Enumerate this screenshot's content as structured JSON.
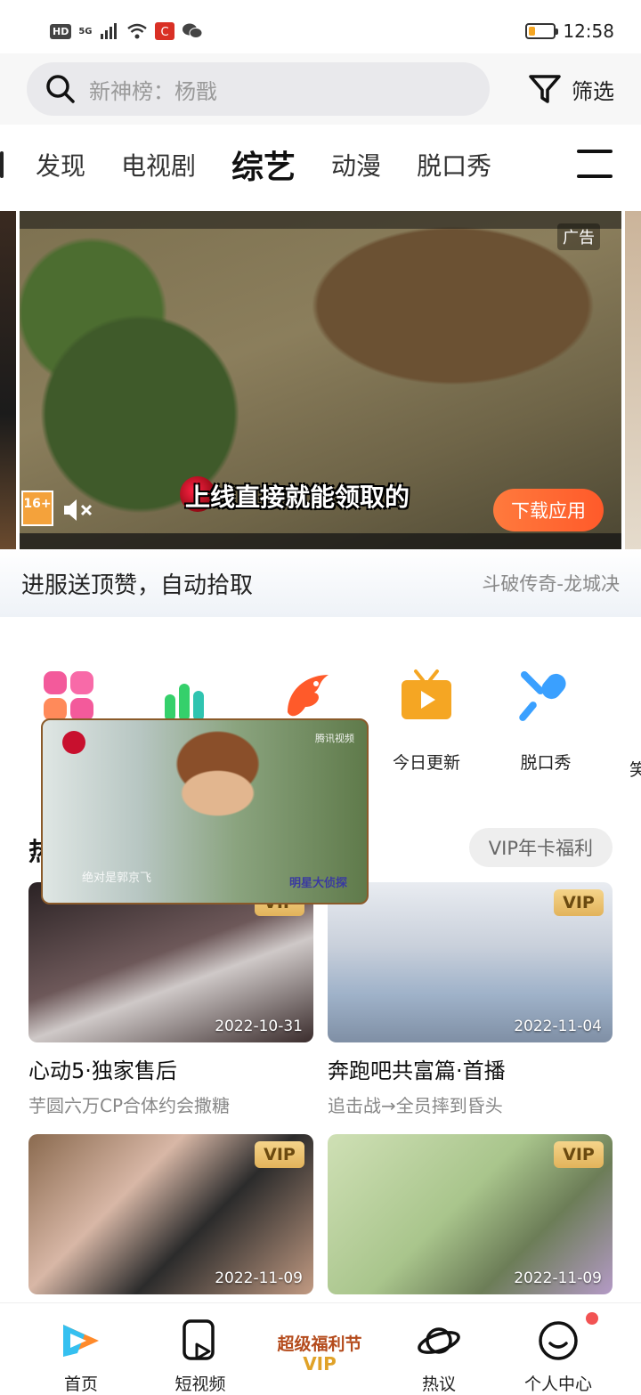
{
  "status_bar": {
    "hd": "HD",
    "network": "5G",
    "time": "12:58",
    "battery_level": 0.25
  },
  "search": {
    "placeholder": "新神榜：杨戬",
    "filter_label": "筛选"
  },
  "tabs": [
    {
      "label": "发现",
      "active": false
    },
    {
      "label": "电视剧",
      "active": false
    },
    {
      "label": "综艺",
      "active": true
    },
    {
      "label": "动漫",
      "active": false
    },
    {
      "label": "脱口秀",
      "active": false
    }
  ],
  "banner": {
    "ad_tag": "广告",
    "caption": "上线直接就能领取的",
    "download_label": "下载应用",
    "age_rating": "16+",
    "title": "进服送顶赞，自动拾取",
    "source": "斗破传奇-龙城决"
  },
  "quick_icons": [
    {
      "label": "",
      "icon": "grid-icon",
      "color": "#f35a9b"
    },
    {
      "label": "",
      "icon": "bars-icon",
      "color": "#35d06b"
    },
    {
      "label": "",
      "icon": "flame-bird-icon",
      "color": "#ff5a2a"
    },
    {
      "label": "今日更新",
      "icon": "tv-play-icon",
      "color": "#f5a623"
    },
    {
      "label": "脱口秀",
      "icon": "microphone-icon",
      "color": "#3aa0ff"
    }
  ],
  "quick_peek_label": "笑",
  "section": {
    "title": "热",
    "vip_welfare": "VIP年卡福利"
  },
  "cards": [
    {
      "title": "心动5·独家售后",
      "subtitle": "芋圆六万CP合体约会撒糖",
      "date": "2022-10-31",
      "badge": "VIP"
    },
    {
      "title": "奔跑吧共富篇·首播",
      "subtitle": "追击战→全员摔到昏头",
      "date": "2022-11-04",
      "badge": "VIP"
    },
    {
      "title": "",
      "subtitle": "",
      "date": "2022-11-09",
      "badge": "VIP"
    },
    {
      "title": "",
      "subtitle": "",
      "date": "2022-11-09",
      "badge": "VIP"
    }
  ],
  "mini_player": {
    "watermark": "腾讯视频",
    "subtitle": "绝对是郭京飞",
    "show_logo": "明星大侦探"
  },
  "bottom_nav": [
    {
      "label": "首页",
      "icon": "home-play-icon"
    },
    {
      "label": "短视频",
      "icon": "short-video-icon"
    },
    {
      "label": "热议",
      "icon": "planet-icon"
    },
    {
      "label": "个人中心",
      "icon": "smiley-face-icon"
    }
  ],
  "promo": {
    "text": "超级福利节",
    "vip": "VIP"
  }
}
